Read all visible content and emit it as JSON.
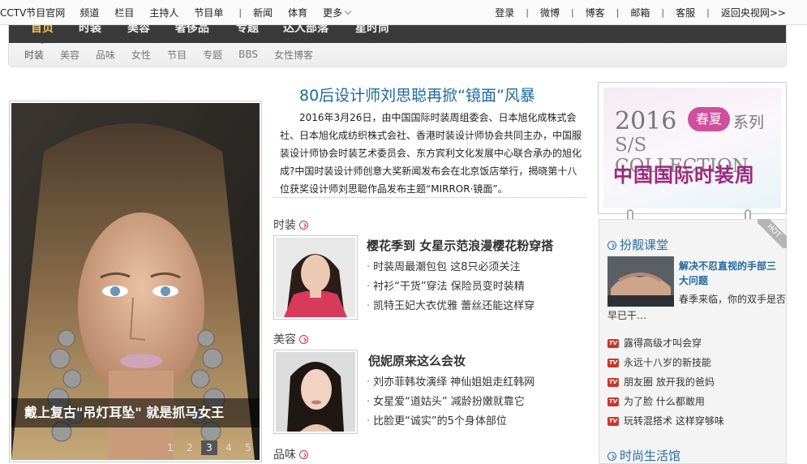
{
  "topbar": {
    "left": [
      "CCTV节目官网",
      "频道",
      "栏目",
      "主持人",
      "节目单"
    ],
    "left2": [
      "新闻",
      "体育",
      "更多"
    ],
    "right": [
      "登录",
      "微博",
      "博客",
      "邮箱",
      "客服",
      "返回央视网>>"
    ]
  },
  "channel_nav": {
    "main": [
      "首页",
      "时装",
      "美容",
      "奢侈品",
      "专题",
      "达人部落",
      "星时尚"
    ],
    "sub": [
      "时装",
      "美容",
      "品味",
      "女性",
      "节目",
      "专题",
      "BBS",
      "女性博客"
    ]
  },
  "hero": {
    "caption": "戴上复古\"吊灯耳坠\" 就是抓马女王",
    "pages": [
      "1",
      "2",
      "3",
      "4",
      "5"
    ],
    "current_page": "3"
  },
  "headline": {
    "title": "80后设计师刘思聪再掀“镜面”风暴",
    "summary": "2016年3月26日，由中国国际时装周组委会、日本旭化成株式会社、日本旭化成纺织株式会社、香港时装设计师协会共同主办，中国服装设计师协会时装艺术委员会、东方宾利文化发展中心联合承办的旭化成?中国时装设计师创意大奖新闻发布会在北京饭店举行，揭晓第十八位获奖设计师刘思聪作品发布主题“MIRROR·镜面”。"
  },
  "sections": [
    {
      "name": "时装",
      "title": "樱花季到  女星示范浪漫樱花粉穿搭",
      "items": [
        "时装周最潮包包 这8只必须关注",
        "衬衫“干货”穿法 保险员变时装精",
        "凯特王妃大衣优雅 蕾丝还能这样穿"
      ]
    },
    {
      "name": "美容",
      "title": "倪妮原来这么会妆",
      "items": [
        "刘亦菲韩妆演绎 神仙姐姐走红韩网",
        "女星爱“道姑头” 减龄扮嫩就靠它",
        "比脸更“诚实”的5个身体部位"
      ]
    },
    {
      "name": "品味"
    }
  ],
  "ad": {
    "year": "2016",
    "pill": "春夏",
    "series": "系列",
    "collection": "S/S COLLECTION",
    "name_cn": "中国国际时装周"
  },
  "side": {
    "hot": "HOT",
    "heading": "扮靓课堂",
    "story_title": "解决不忍直视的手部三大问题",
    "story_desc": "春季来临，你的双手是否早已干…",
    "tv_badge": "TV",
    "tv_items": [
      "露得高级才叫会穿",
      "永远十八岁的新技能",
      "朋友圈 放开我的爸妈",
      "为了脸 什么都敢用",
      "玩转混搭术 这样穿够味"
    ],
    "heading2": "时尚生活馆"
  },
  "colors": {
    "link_blue": "#1d6aa0",
    "accent_red": "#c8372d",
    "nav_dark": "#3a3a3a"
  }
}
